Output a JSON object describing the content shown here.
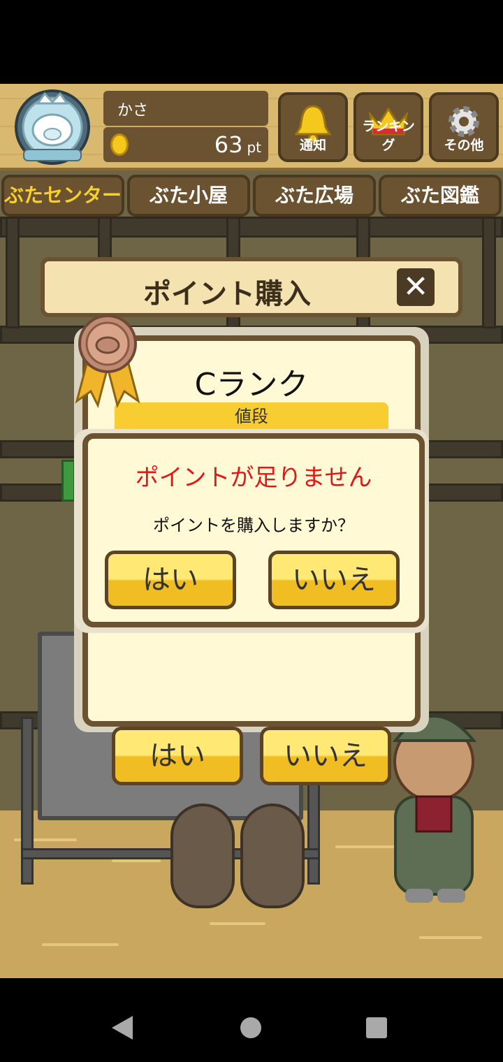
{
  "colors": {
    "wood": "#d9b870",
    "wood_dark": "#6b5231",
    "button_yellow": "#f0bd22",
    "alert_red": "#e01818",
    "active_tab": "#f7d02a"
  },
  "header": {
    "player_name": "かさ",
    "points_value": "63",
    "points_unit": "pt",
    "buttons": [
      {
        "label": "通知",
        "icon": "bell-icon"
      },
      {
        "label": "ランキング",
        "icon": "crown-icon"
      },
      {
        "label": "その他",
        "icon": "gear-icon"
      }
    ]
  },
  "tabs": [
    {
      "label": "ぶたセンター",
      "active": true
    },
    {
      "label": "ぶた小屋",
      "active": false
    },
    {
      "label": "ぶた広場",
      "active": false
    },
    {
      "label": "ぶた図鑑",
      "active": false
    }
  ],
  "purchase": {
    "title": "ポイント購入",
    "close_icon": "close-icon",
    "rank": "Cランク",
    "price_header": "値段",
    "yes": "はい",
    "no": "いいえ"
  },
  "alert": {
    "title": "ポイントが足りません",
    "message": "ポイントを購入しますか？",
    "yes": "はい",
    "no": "いいえ"
  },
  "nav": {
    "back_icon": "back-icon",
    "home_icon": "home-icon",
    "recent_icon": "recent-apps-icon"
  }
}
